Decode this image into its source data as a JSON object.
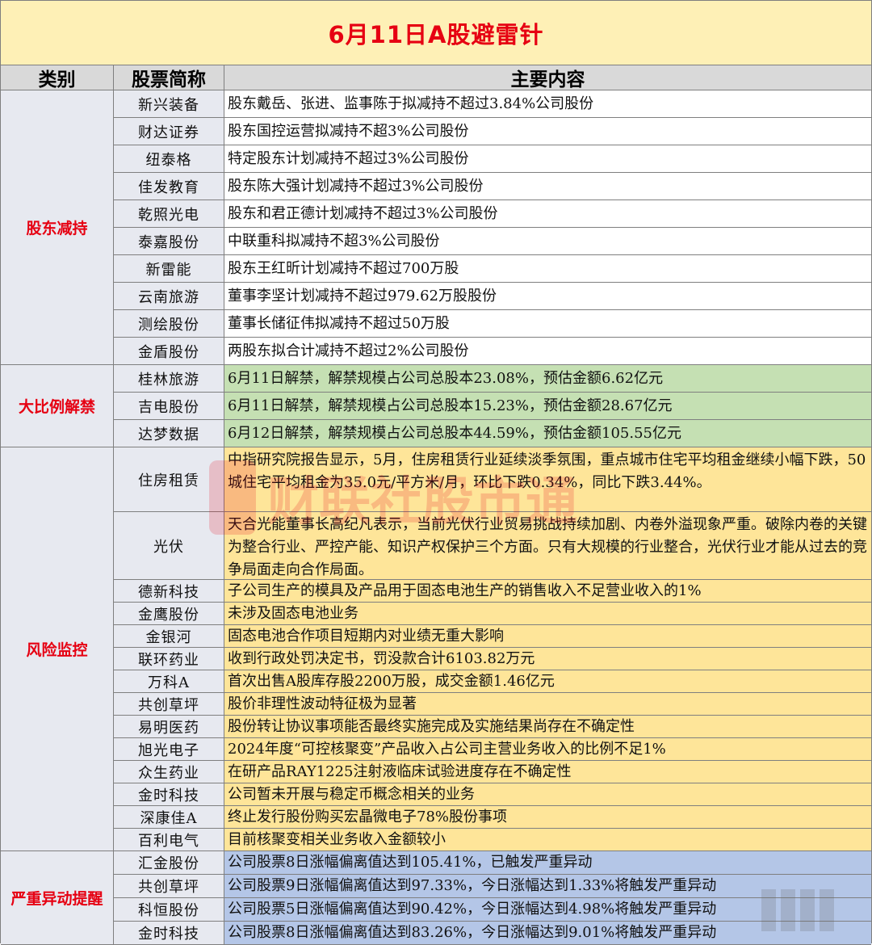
{
  "title": "6月11日A股避雷针",
  "headers": {
    "category": "类别",
    "name": "股票简称",
    "content": "主要内容"
  },
  "groups": [
    {
      "category": "股东减持",
      "rows": [
        {
          "name": "新兴装备",
          "content": "股东戴岳、张进、监事陈于拟减持不超过3.84%公司股份"
        },
        {
          "name": "财达证券",
          "content": "股东国控运营拟减持不超3%公司股份"
        },
        {
          "name": "纽泰格",
          "content": "特定股东计划减持不超过3%公司股份"
        },
        {
          "name": "佳发教育",
          "content": "股东陈大强计划减持不超过3%公司股份"
        },
        {
          "name": "乾照光电",
          "content": "股东和君正德计划减持不超过3%公司股份"
        },
        {
          "name": "泰嘉股份",
          "content": "中联重科拟减持不超3%公司股份"
        },
        {
          "name": "新雷能",
          "content": "股东王红昕计划减持不超过700万股"
        },
        {
          "name": "云南旅游",
          "content": "董事李坚计划减持不超过979.62万股股份"
        },
        {
          "name": "测绘股份",
          "content": "董事长储征伟拟减持不超过50万股"
        },
        {
          "name": "金盾股份",
          "content": "两股东拟合计减持不超过2%公司股份"
        }
      ]
    },
    {
      "category": "大比例解禁",
      "rows": [
        {
          "name": "桂林旅游",
          "content": "6月11日解禁，解禁规模占公司总股本23.08%，预估金额6.62亿元"
        },
        {
          "name": "吉电股份",
          "content": "6月11日解禁，解禁规模占公司总股本15.23%，预估金额28.67亿元"
        },
        {
          "name": "达梦数据",
          "content": "6月12日解禁，解禁规模占公司总股本44.59%，预估金额105.55亿元"
        }
      ]
    },
    {
      "category": "风险监控",
      "rows": [
        {
          "name": "住房租赁",
          "content": "中指研究院报告显示，5月，住房租赁行业延续淡季氛围，重点城市住宅平均租金继续小幅下跌，50城住宅平均租金为35.0元/平方米/月，环比下跌0.34%，同比下跌3.44%。"
        },
        {
          "name": "光伏",
          "content": "天合光能董事长高纪凡表示，当前光伏行业贸易挑战持续加剧、内卷外溢现象严重。破除内卷的关键为整合行业、严控产能、知识产权保护三个方面。只有大规模的行业整合，光伏行业才能从过去的竞争局面走向合作局面。"
        },
        {
          "name": "德新科技",
          "content": "子公司生产的模具及产品用于固态电池生产的销售收入不足营业收入的1%"
        },
        {
          "name": "金鹰股份",
          "content": "未涉及固态电池业务"
        },
        {
          "name": "金银河",
          "content": "固态电池合作项目短期内对业绩无重大影响"
        },
        {
          "name": "联环药业",
          "content": "收到行政处罚决定书，罚没款合计6103.82万元"
        },
        {
          "name": "万科A",
          "content": "首次出售A股库存股2200万股，成交金额1.46亿元"
        },
        {
          "name": "共创草坪",
          "content": "股价非理性波动特征极为显著"
        },
        {
          "name": "易明医药",
          "content": "股份转让协议事项能否最终实施完成及实施结果尚存在不确定性"
        },
        {
          "name": "旭光电子",
          "content": "2024年度“可控核聚变”产品收入占公司主营业务收入的比例不足1%"
        },
        {
          "name": "众生药业",
          "content": "在研产品RAY1225注射液临床试验进度存在不确定性"
        },
        {
          "name": "金时科技",
          "content": "公司暂未开展与稳定币概念相关的业务"
        },
        {
          "name": "深康佳A",
          "content": "终止发行股份购买宏晶微电子78%股份事项"
        },
        {
          "name": "百利电气",
          "content": "目前核聚变相关业务收入金额较小"
        }
      ]
    },
    {
      "category": "严重异动提醒",
      "rows": [
        {
          "name": "汇金股份",
          "content": "公司股票8日涨幅偏离值达到105.41%，已触发严重异动"
        },
        {
          "name": "共创草坪",
          "content": "公司股票9日涨幅偏离值达到97.33%，今日涨幅达到1.33%将触发严重异动"
        },
        {
          "name": "科恒股份",
          "content": "公司股票5日涨幅偏离值达到90.42%，今日涨幅达到4.98%将触发严重异动"
        },
        {
          "name": "金时科技",
          "content": "公司股票8日涨幅偏离值达到83.26%，今日涨幅达到9.01%将触发严重异动"
        }
      ]
    }
  ],
  "watermark": {
    "text": "财联社股市通"
  },
  "colors": {
    "title_bg": "#fef0b6",
    "title_text": "#e60012",
    "header_bg": "#d9d9d9",
    "unlock_bg": "#c5e0b3",
    "risk_bg": "#fee599",
    "alert_bg": "#b4c6e7",
    "category_text": "#e60012"
  }
}
